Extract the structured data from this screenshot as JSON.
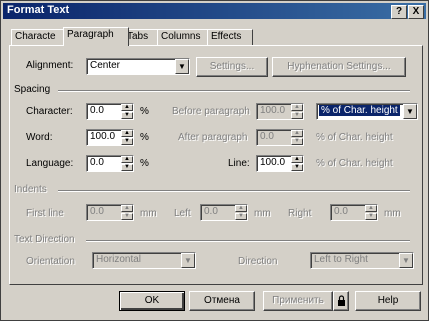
{
  "window": {
    "title": "Format Text",
    "help_glyph": "?",
    "close_glyph": "X"
  },
  "tabs": [
    "Characte",
    "Paragraph",
    "Tabs",
    "Columns",
    "Effects"
  ],
  "alignment": {
    "label": "Alignment:",
    "value": "Center",
    "settings_button": "Settings...",
    "hyphenation_button": "Hyphenation Settings..."
  },
  "spacing": {
    "header": "Spacing",
    "character_label": "Character:",
    "character_value": "0.0",
    "character_unit": "%",
    "word_label": "Word:",
    "word_value": "100.0",
    "word_unit": "%",
    "language_label": "Language:",
    "language_value": "0.0",
    "language_unit": "%",
    "before_label": "Before paragraph",
    "before_value": "100.0",
    "before_unit_select": "% of Char. height",
    "after_label": "After paragraph",
    "after_value": "0.0",
    "after_unit": "% of Char. height",
    "line_label": "Line:",
    "line_value": "100.0",
    "line_unit": "% of Char. height"
  },
  "indents": {
    "header": "Indents",
    "first_line_label": "First line",
    "first_line_value": "0.0",
    "first_line_unit": "mm",
    "left_label": "Left",
    "left_value": "0.0",
    "left_unit": "mm",
    "right_label": "Right",
    "right_value": "0.0",
    "right_unit": "mm"
  },
  "text_direction": {
    "header": "Text Direction",
    "orientation_label": "Orientation",
    "orientation_value": "Horizontal",
    "direction_label": "Direction",
    "direction_value": "Left to Right"
  },
  "footer": {
    "ok": "OK",
    "cancel": "Отмена",
    "apply": "Применить",
    "help": "Help"
  }
}
